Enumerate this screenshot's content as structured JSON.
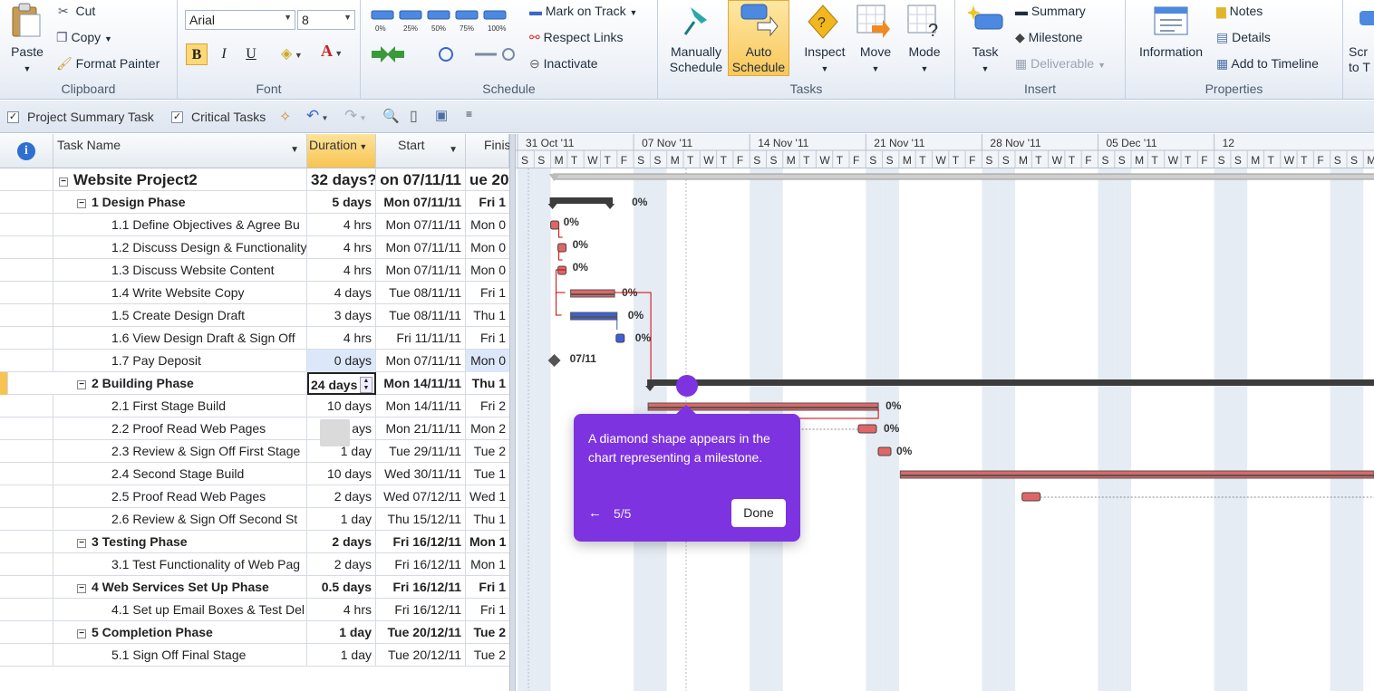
{
  "ribbon": {
    "clipboard": {
      "paste": "Paste",
      "cut": "Cut",
      "copy": "Copy",
      "format_painter": "Format Painter",
      "label": "Clipboard"
    },
    "font": {
      "family": "Arial",
      "size": "8",
      "bold": "B",
      "italic": "I",
      "underline": "U",
      "label": "Font"
    },
    "schedule": {
      "pcts": [
        "0%",
        "25%",
        "50%",
        "75%",
        "100%"
      ],
      "mark_on_track": "Mark on Track",
      "respect_links": "Respect Links",
      "inactivate": "Inactivate",
      "label": "Schedule"
    },
    "tasks": {
      "manually": [
        "Manually",
        "Schedule"
      ],
      "auto": [
        "Auto",
        "Schedule"
      ],
      "inspect": "Inspect",
      "move": "Move",
      "mode": "Mode",
      "label": "Tasks"
    },
    "insert": {
      "task": "Task",
      "summary": "Summary",
      "milestone": "Milestone",
      "deliverable": "Deliverable",
      "label": "Insert"
    },
    "properties": {
      "information": "Information",
      "notes": "Notes",
      "details": "Details",
      "add_to_timeline": "Add to Timeline",
      "label": "Properties"
    },
    "scroll": [
      "Scr",
      "to T"
    ]
  },
  "qat": {
    "project_summary": "Project Summary Task",
    "critical_tasks": "Critical Tasks"
  },
  "table": {
    "headers": {
      "info": "i",
      "task_name": "Task Name",
      "duration": "Duration",
      "start": "Start",
      "finish": "Finis"
    },
    "rows": [
      {
        "name": "Website Project2",
        "duration": "32 days?",
        "start": "on 07/11/11",
        "finish": "ue 20",
        "level": 0,
        "summary": true,
        "top": true
      },
      {
        "name": "1 Design Phase",
        "duration": "5 days",
        "start": "Mon 07/11/11",
        "finish": "Fri 1",
        "level": 1,
        "summary": true
      },
      {
        "name": "1.1 Define Objectives & Agree Bu",
        "duration": "4 hrs",
        "start": "Mon 07/11/11",
        "finish": "Mon 0",
        "level": 2
      },
      {
        "name": "1.2 Discuss Design & Functionality",
        "duration": "4 hrs",
        "start": "Mon 07/11/11",
        "finish": "Mon 0",
        "level": 2
      },
      {
        "name": "1.3 Discuss Website Content",
        "duration": "4 hrs",
        "start": "Mon 07/11/11",
        "finish": "Mon 0",
        "level": 2
      },
      {
        "name": "1.4 Write Website Copy",
        "duration": "4 days",
        "start": "Tue 08/11/11",
        "finish": "Fri 1",
        "level": 2
      },
      {
        "name": "1.5 Create Design Draft",
        "duration": "3 days",
        "start": "Tue 08/11/11",
        "finish": "Thu 1",
        "level": 2
      },
      {
        "name": "1.6 View Design Draft & Sign Off",
        "duration": "4 hrs",
        "start": "Fri 11/11/11",
        "finish": "Fri 1",
        "level": 2
      },
      {
        "name": "1.7 Pay Deposit",
        "duration": "0 days",
        "start": "Mon 07/11/11",
        "finish": "Mon 0",
        "level": 2,
        "selected": true
      },
      {
        "name": "2 Building Phase",
        "duration": "24 days",
        "start": "Mon 14/11/11",
        "finish": "Thu 1",
        "level": 1,
        "summary": true,
        "editing": true
      },
      {
        "name": "2.1 First Stage Build",
        "duration": "10 days",
        "start": "Mon 14/11/11",
        "finish": "Fri 2",
        "level": 2
      },
      {
        "name": "2.2 Proof Read Web Pages",
        "duration": "ays",
        "start": "Mon 21/11/11",
        "finish": "Mon 2",
        "level": 2
      },
      {
        "name": "2.3 Review & Sign Off First Stage",
        "duration": "1 day",
        "start": "Tue 29/11/11",
        "finish": "Tue 2",
        "level": 2
      },
      {
        "name": "2.4 Second Stage Build",
        "duration": "10 days",
        "start": "Wed 30/11/11",
        "finish": "Tue 1",
        "level": 2
      },
      {
        "name": "2.5 Proof Read Web Pages",
        "duration": "2 days",
        "start": "Wed 07/12/11",
        "finish": "Wed 1",
        "level": 2
      },
      {
        "name": "2.6 Review & Sign Off Second St",
        "duration": "1 day",
        "start": "Thu 15/12/11",
        "finish": "Thu 1",
        "level": 2
      },
      {
        "name": "3 Testing Phase",
        "duration": "2 days",
        "start": "Fri 16/12/11",
        "finish": "Mon 1",
        "level": 1,
        "summary": true
      },
      {
        "name": "3.1 Test Functionality of Web Pag",
        "duration": "2 days",
        "start": "Fri 16/12/11",
        "finish": "Mon 1",
        "level": 2
      },
      {
        "name": "4 Web Services Set Up Phase",
        "duration": "0.5 days",
        "start": "Fri 16/12/11",
        "finish": "Fri 1",
        "level": 1,
        "summary": true
      },
      {
        "name": "4.1 Set up Email Boxes & Test Del",
        "duration": "4 hrs",
        "start": "Fri 16/12/11",
        "finish": "Fri 1",
        "level": 2
      },
      {
        "name": "5 Completion Phase",
        "duration": "1 day",
        "start": "Tue 20/12/11",
        "finish": "Tue 2",
        "level": 1,
        "summary": true
      },
      {
        "name": "5.1 Sign Off Final Stage",
        "duration": "1 day",
        "start": "Tue 20/12/11",
        "finish": "Tue 2",
        "level": 2
      }
    ]
  },
  "gantt": {
    "weeks": [
      "31 Oct '11",
      "07 Nov '11",
      "14 Nov '11",
      "21 Nov '11",
      "28 Nov '11",
      "05 Dec '11",
      "12"
    ],
    "days": [
      "S",
      "S",
      "M",
      "T",
      "W",
      "T",
      "F"
    ],
    "milestone_label": "07/11",
    "pct_label": "0%"
  },
  "tooltip": {
    "text": "A diamond shape appears in the chart representing a milestone.",
    "back": "←",
    "step": "5/5",
    "done": "Done"
  },
  "colors": {
    "accent": "#7e33e0",
    "summary_bar": "#3c3c3c",
    "critical": "#e06666",
    "task_blue": "#3d5fd8"
  }
}
